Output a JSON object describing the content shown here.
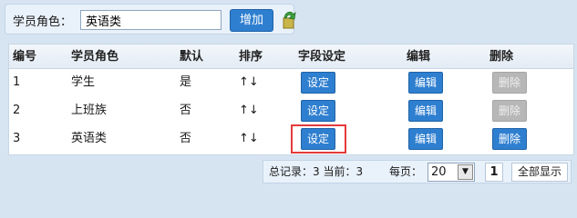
{
  "search": {
    "label": "学员角色：",
    "value": "英语类",
    "add_label": "增加"
  },
  "table": {
    "headers": [
      "编号",
      "学员角色",
      "默认",
      "排序",
      "字段设定",
      "编辑",
      "删除"
    ],
    "rows": [
      {
        "id": "1",
        "role": "学生",
        "default": "是",
        "sort": "↑↓",
        "field": "设定",
        "edit": "编辑",
        "delete": "删除",
        "delete_enabled": false
      },
      {
        "id": "2",
        "role": "上班族",
        "default": "否",
        "sort": "↑↓",
        "field": "设定",
        "edit": "编辑",
        "delete": "删除",
        "delete_enabled": false
      },
      {
        "id": "3",
        "role": "英语类",
        "default": "否",
        "sort": "↑↓",
        "field": "设定",
        "edit": "编辑",
        "delete": "删除",
        "delete_enabled": true
      }
    ]
  },
  "pager": {
    "summary": "总记录：3 当前：3",
    "per_page_label": "每页：",
    "per_page": "20",
    "page": "1",
    "show_all": "全部显示"
  },
  "colors": {
    "primary": "#2f7fd0",
    "disabled": "#b7b7b7",
    "highlight": "#e53a3a",
    "background": "#d6e4f2"
  }
}
